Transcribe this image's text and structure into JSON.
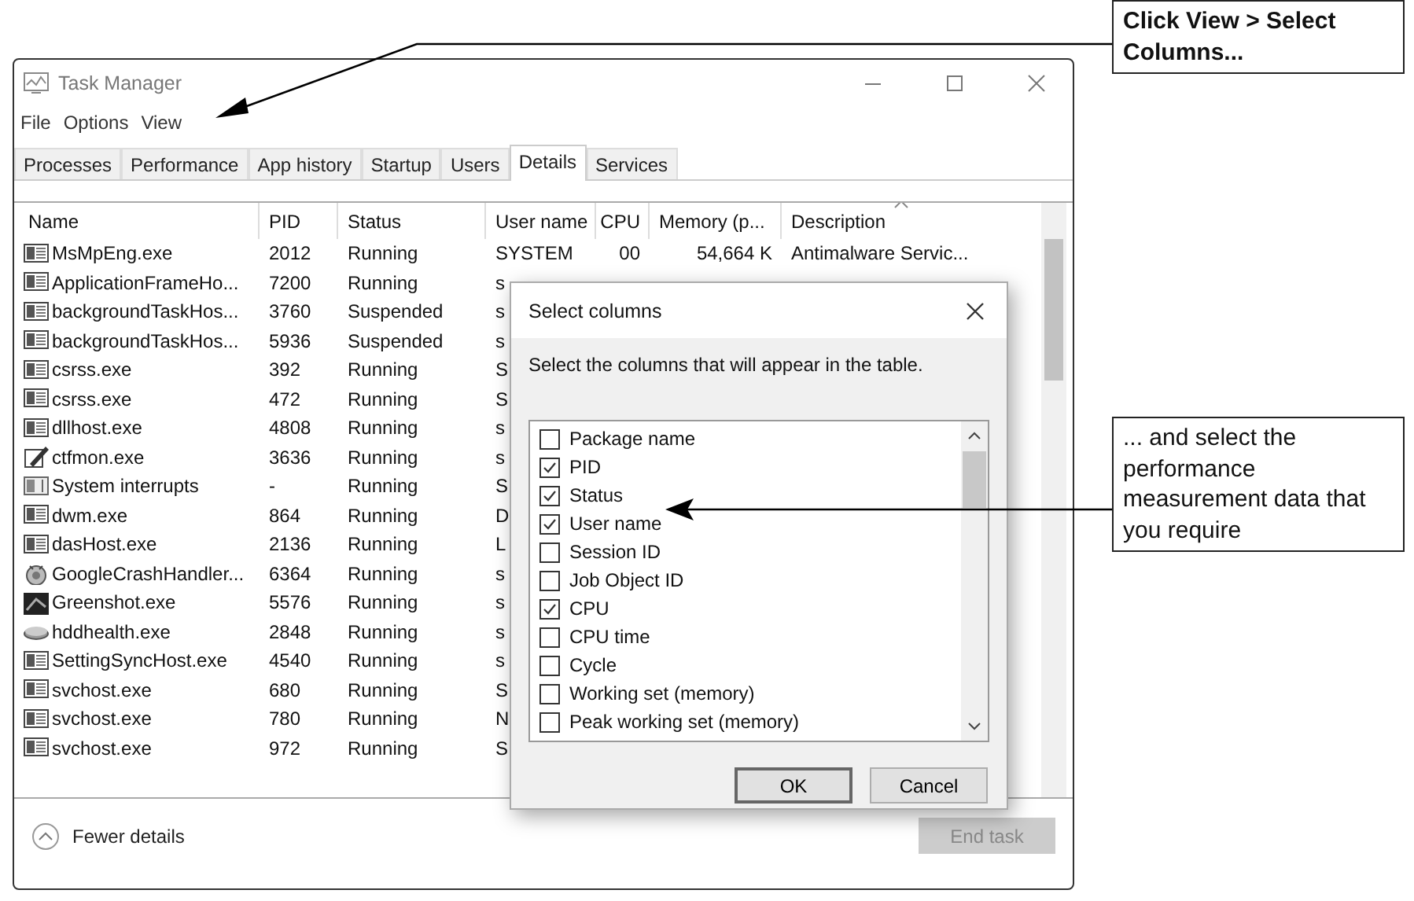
{
  "window": {
    "title": "Task Manager"
  },
  "menu": [
    "File",
    "Options",
    "View"
  ],
  "tabs": [
    {
      "label": "Processes",
      "selected": false
    },
    {
      "label": "Performance",
      "selected": false
    },
    {
      "label": "App history",
      "selected": false
    },
    {
      "label": "Startup",
      "selected": false
    },
    {
      "label": "Users",
      "selected": false
    },
    {
      "label": "Details",
      "selected": true
    },
    {
      "label": "Services",
      "selected": false
    }
  ],
  "table": {
    "columns": [
      {
        "label": "Name",
        "sorted": false
      },
      {
        "label": "PID",
        "sorted": false
      },
      {
        "label": "Status",
        "sorted": false
      },
      {
        "label": "User name",
        "sorted": false
      },
      {
        "label": "CPU",
        "sorted": false
      },
      {
        "label": "Memory (p...",
        "sorted": false
      },
      {
        "label": "Description",
        "sorted": true
      }
    ],
    "rows": [
      {
        "kind": "app",
        "name": "MsMpEng.exe",
        "pid": "2012",
        "status": "Running",
        "user": "SYSTEM",
        "cpu": "00",
        "memory": "54,664 K",
        "description": "Antimalware Servic..."
      },
      {
        "kind": "app",
        "name": "ApplicationFrameHo...",
        "pid": "7200",
        "status": "Running",
        "user": "s"
      },
      {
        "kind": "app",
        "name": "backgroundTaskHos...",
        "pid": "3760",
        "status": "Suspended",
        "user": "s"
      },
      {
        "kind": "app",
        "name": "backgroundTaskHos...",
        "pid": "5936",
        "status": "Suspended",
        "user": "s"
      },
      {
        "kind": "app",
        "name": "csrss.exe",
        "pid": "392",
        "status": "Running",
        "user": "S"
      },
      {
        "kind": "app",
        "name": "csrss.exe",
        "pid": "472",
        "status": "Running",
        "user": "S"
      },
      {
        "kind": "app",
        "name": "dllhost.exe",
        "pid": "4808",
        "status": "Running",
        "user": "s"
      },
      {
        "kind": "pen",
        "name": "ctfmon.exe",
        "pid": "3636",
        "status": "Running",
        "user": "s"
      },
      {
        "kind": "system",
        "name": "System interrupts",
        "pid": "-",
        "status": "Running",
        "user": "S"
      },
      {
        "kind": "app",
        "name": "dwm.exe",
        "pid": "864",
        "status": "Running",
        "user": "D"
      },
      {
        "kind": "app",
        "name": "dasHost.exe",
        "pid": "2136",
        "status": "Running",
        "user": "L"
      },
      {
        "kind": "globe",
        "name": "GoogleCrashHandler...",
        "pid": "6364",
        "status": "Running",
        "user": "s"
      },
      {
        "kind": "dark",
        "name": "Greenshot.exe",
        "pid": "5576",
        "status": "Running",
        "user": "s"
      },
      {
        "kind": "drive",
        "name": "hddhealth.exe",
        "pid": "2848",
        "status": "Running",
        "user": "s"
      },
      {
        "kind": "app",
        "name": "SettingSyncHost.exe",
        "pid": "4540",
        "status": "Running",
        "user": "s"
      },
      {
        "kind": "app",
        "name": "svchost.exe",
        "pid": "680",
        "status": "Running",
        "user": "S"
      },
      {
        "kind": "app",
        "name": "svchost.exe",
        "pid": "780",
        "status": "Running",
        "user": "N"
      },
      {
        "kind": "app",
        "name": "svchost.exe",
        "pid": "972",
        "status": "Running",
        "user": "S"
      }
    ]
  },
  "dialog": {
    "title": "Select columns",
    "instruction": "Select the columns that will appear in the table.",
    "options": [
      {
        "label": "Package name",
        "checked": false
      },
      {
        "label": "PID",
        "checked": true
      },
      {
        "label": "Status",
        "checked": true
      },
      {
        "label": "User name",
        "checked": true
      },
      {
        "label": "Session ID",
        "checked": false
      },
      {
        "label": "Job Object ID",
        "checked": false
      },
      {
        "label": "CPU",
        "checked": true
      },
      {
        "label": "CPU time",
        "checked": false
      },
      {
        "label": "Cycle",
        "checked": false
      },
      {
        "label": "Working set (memory)",
        "checked": false
      },
      {
        "label": "Peak working set (memory)",
        "checked": false
      }
    ],
    "buttons": [
      {
        "label": "OK",
        "default": true
      },
      {
        "label": "Cancel",
        "default": false
      }
    ]
  },
  "footer": {
    "toggle": "Fewer details",
    "end_task": {
      "label": "End task",
      "disabled": true
    }
  },
  "callouts": [
    {
      "text": "Click View > Select Columns..."
    },
    {
      "text": "... and select the performance measurement data that you require"
    }
  ]
}
